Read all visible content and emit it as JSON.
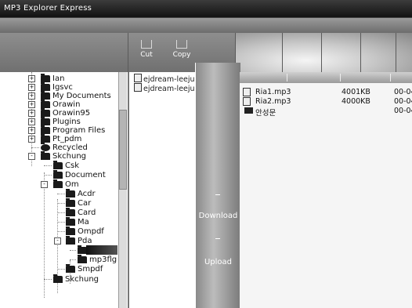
{
  "window": {
    "title": "MP3 Explorer Express"
  },
  "toolbar": {
    "cut_label": "Cut",
    "copy_label": "Copy"
  },
  "tree": {
    "items": [
      {
        "label": "Ian",
        "level": 1,
        "expander": "+"
      },
      {
        "label": "Igsvc",
        "level": 1,
        "expander": "+"
      },
      {
        "label": "My Documents",
        "level": 1,
        "expander": "+"
      },
      {
        "label": "Orawin",
        "level": 1,
        "expander": "+"
      },
      {
        "label": "Orawin95",
        "level": 1,
        "expander": "+"
      },
      {
        "label": "Plugins",
        "level": 1,
        "expander": "+"
      },
      {
        "label": "Program Files",
        "level": 1,
        "expander": "+"
      },
      {
        "label": "Pt_pdm",
        "level": 1,
        "expander": "+"
      },
      {
        "label": "Recycled",
        "level": 1,
        "expander": ""
      },
      {
        "label": "Skchung",
        "level": 1,
        "expander": "-"
      },
      {
        "label": "Csk",
        "level": 2,
        "expander": ""
      },
      {
        "label": "Document",
        "level": 2,
        "expander": ""
      },
      {
        "label": "Om",
        "level": 2,
        "expander": "-"
      },
      {
        "label": "Acdr",
        "level": 3,
        "expander": ""
      },
      {
        "label": "Car",
        "level": 3,
        "expander": ""
      },
      {
        "label": "Card",
        "level": 3,
        "expander": ""
      },
      {
        "label": "Ma",
        "level": 3,
        "expander": ""
      },
      {
        "label": "Ompdf",
        "level": 3,
        "expander": ""
      },
      {
        "label": "Pda",
        "level": 3,
        "expander": "-"
      },
      {
        "label": "",
        "level": 4,
        "expander": ""
      },
      {
        "label": "mp3flg",
        "level": 4,
        "expander": ""
      },
      {
        "label": "Smpdf",
        "level": 3,
        "expander": ""
      },
      {
        "label": "Skchung",
        "level": 2,
        "expander": ""
      }
    ]
  },
  "middle_files": [
    {
      "name": "ejdream-leeju"
    },
    {
      "name": "ejdream-leeju"
    }
  ],
  "side_buttons": {
    "download_label": "Download",
    "upload_label": "Upload"
  },
  "device_files": [
    {
      "name": "Ria1.mp3",
      "size": "4001KB",
      "date": "00-04"
    },
    {
      "name": "Ria2.mp3",
      "size": "4000KB",
      "date": "00-04"
    },
    {
      "name": "안성문",
      "size": "",
      "date": "00-04",
      "is_folder": true
    }
  ]
}
